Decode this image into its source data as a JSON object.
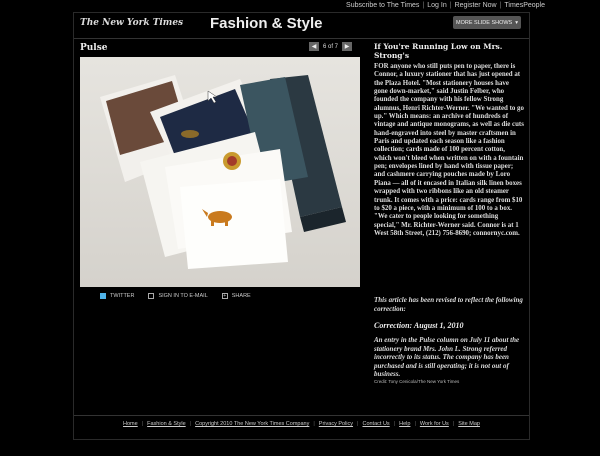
{
  "topnav": {
    "subscribe": "Subscribe to The Times",
    "login": "Log In",
    "register": "Register Now",
    "timespeople": "TimesPeople"
  },
  "header": {
    "logo": "The New York Times",
    "section": "Fashion & Style",
    "more_button": "MORE SLIDE SHOWS"
  },
  "slideshow": {
    "title": "Pulse",
    "counter": "6 of 7"
  },
  "share": {
    "twitter": "TWITTER",
    "signin": "SIGN IN TO E-MAIL",
    "share": "SHARE"
  },
  "article": {
    "title": "If You're Running Low on Mrs. Strong's",
    "body": "FOR anyone who still puts pen to paper, there is Connor, a luxury stationer that has just opened at the Plaza Hotel. \"Most stationery houses have gone down-market,\" said Justin Felber, who founded the company with his fellow Strong alumnus, Henri Richter-Werner. \"We wanted to go up.\" Which means: an archive of hundreds of vintage and antique monograms, as well as die cuts hand-engraved into steel by master craftsmen in Paris and updated each season like a fashion collection; cards made of 100 percent cotton, which won't bleed when written on with a fountain pen; envelopes lined by hand with tissue paper; and cashmere carrying pouches made by Loro Piana — all of it encased in Italian silk linen boxes wrapped with two ribbons like an old steamer trunk. It comes with a price: cards range from $10 to $20 a piece, with a minimum of 100 to a box. \"We cater to people looking for something special,\" Mr. Richter-Werner said. Connor is at 1 West 58th Street, (212) 756-8690; connornyc.com.",
    "revised": "This article has been revised to reflect the following correction:",
    "correction_heading": "Correction: August 1, 2010",
    "correction_body": "An entry in the Pulse column on July 11 about the stationery brand Mrs. John L. Strong referred incorrectly to its status. The company has been purchased and is still operating; it is not out of business.",
    "credit": "Credit: Tony Cenicola/The New York Times"
  },
  "footer": {
    "links": [
      "Home",
      "Fashion & Style",
      "Copyright 2010 The New York Times Company",
      "Privacy Policy",
      "Contact Us",
      "Help",
      "Work for Us",
      "Site Map"
    ]
  },
  "colors": {
    "background": "#000000",
    "twitter_blue": "#4fb3e8",
    "button_gray": "#555555"
  }
}
